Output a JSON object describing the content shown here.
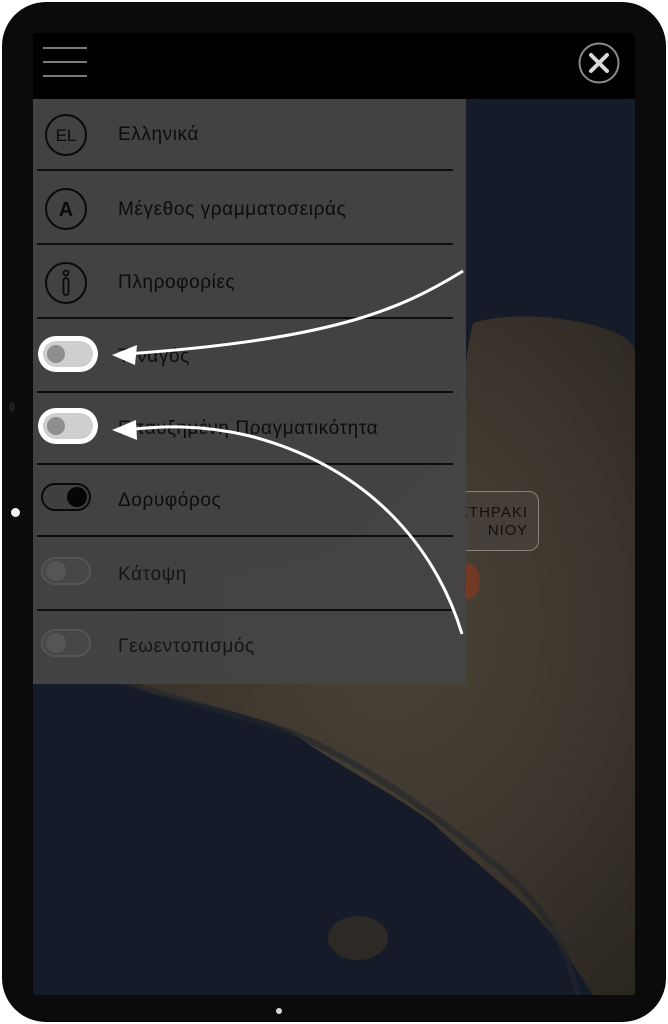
{
  "colors": {
    "bezel": "#0b0b0b",
    "topbar": "#000000",
    "menu_panel": "#444444",
    "text": "#0c0c0c",
    "arrow": "#ffffff"
  },
  "topbar": {
    "menu_icon": "hamburger-icon",
    "close_icon": "close-icon"
  },
  "menu": {
    "items": [
      {
        "label": "Ελληνικά",
        "icon": "language-el-icon",
        "icon_text": "EL",
        "kind": "icon"
      },
      {
        "label": "Μέγεθος γραμματοσειράς",
        "icon": "font-size-icon",
        "icon_text": "A",
        "kind": "icon"
      },
      {
        "label": "Πληροφορίες",
        "icon": "info-icon",
        "kind": "icon"
      },
      {
        "label": "Τεναγός",
        "kind": "toggle",
        "checked": false,
        "highlighted": true
      },
      {
        "label": "Επαυξημένη Πραγματικότητα",
        "kind": "toggle",
        "checked": false,
        "highlighted": true
      },
      {
        "label": "Δορυφόρος",
        "kind": "toggle",
        "checked": true
      },
      {
        "label": "Κάτοψη",
        "kind": "toggle",
        "checked": false
      },
      {
        "label": "Γεωεντοπισμός",
        "kind": "toggle",
        "checked": false
      }
    ]
  },
  "map": {
    "marker_label_line1": "ΠΗΓΗ ΣΤΗΡΑΚΙ",
    "marker_label_line2": "ΝΙΟΥ"
  },
  "annotations": {
    "arrows": [
      "arrow-to-tenagos-toggle",
      "arrow-to-ar-toggle"
    ]
  }
}
